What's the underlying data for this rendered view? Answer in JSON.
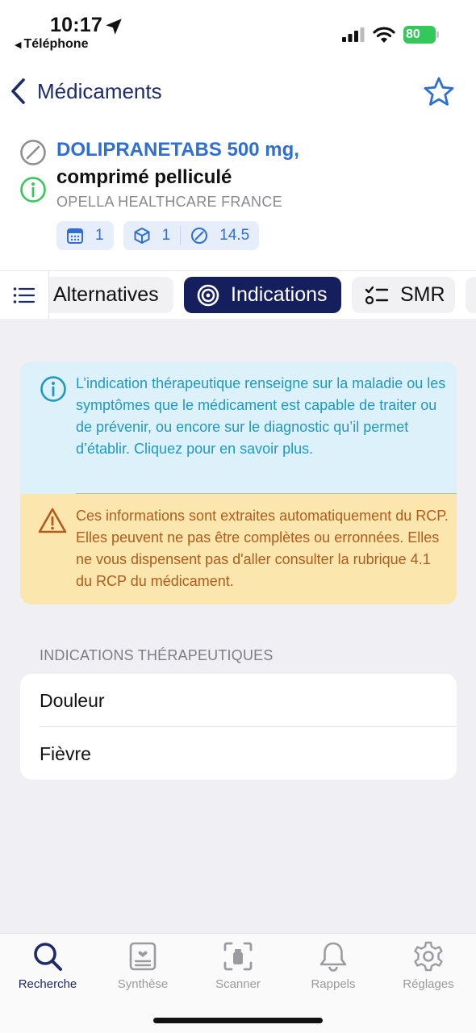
{
  "status": {
    "time": "10:17",
    "back_app": "Téléphone",
    "battery": "80"
  },
  "nav": {
    "back_label": "Médicaments"
  },
  "drug": {
    "name": "DOLIPRANETABS 500 mg,",
    "form": "comprimé pelliculé",
    "lab": "OPELLA HEALTHCARE FRANCE",
    "chips": {
      "calendar_count": "1",
      "box_count": "1",
      "price": "14.5"
    }
  },
  "tabs": [
    {
      "label": "Alternatives"
    },
    {
      "label": "Indications"
    },
    {
      "label": "SMR"
    }
  ],
  "info_card": {
    "text": "L’indication thérapeutique renseigne sur la maladie ou les symptômes que le médicament est capable de traiter ou de prévenir, ou encore sur le diagnostic qu’il permet d’établir. Cliquez pour en savoir plus."
  },
  "warning_card": {
    "text": "Ces informations sont extraites automatiquement du RCP. Elles peuvent ne pas être complètes ou erronnées. Elles ne vous dispensent pas d'aller consulter la rubrique 4.1 du RCP du médicament."
  },
  "indications": {
    "section_title": "INDICATIONS THÉRAPEUTIQUES",
    "items": [
      {
        "label": "Douleur"
      },
      {
        "label": "Fièvre"
      }
    ]
  },
  "bottom_tabs": [
    {
      "label": "Recherche",
      "icon": "search-icon",
      "active": true
    },
    {
      "label": "Synthèse",
      "icon": "summary-icon"
    },
    {
      "label": "Scanner",
      "icon": "scanner-icon"
    },
    {
      "label": "Rappels",
      "icon": "bell-icon"
    },
    {
      "label": "Réglages",
      "icon": "gear-icon"
    }
  ],
  "colors": {
    "brand_navy": "#161f5e",
    "link_blue": "#2f6ed6",
    "info_bg": "#ddf1fb",
    "warning_bg": "#fbe7ad"
  }
}
